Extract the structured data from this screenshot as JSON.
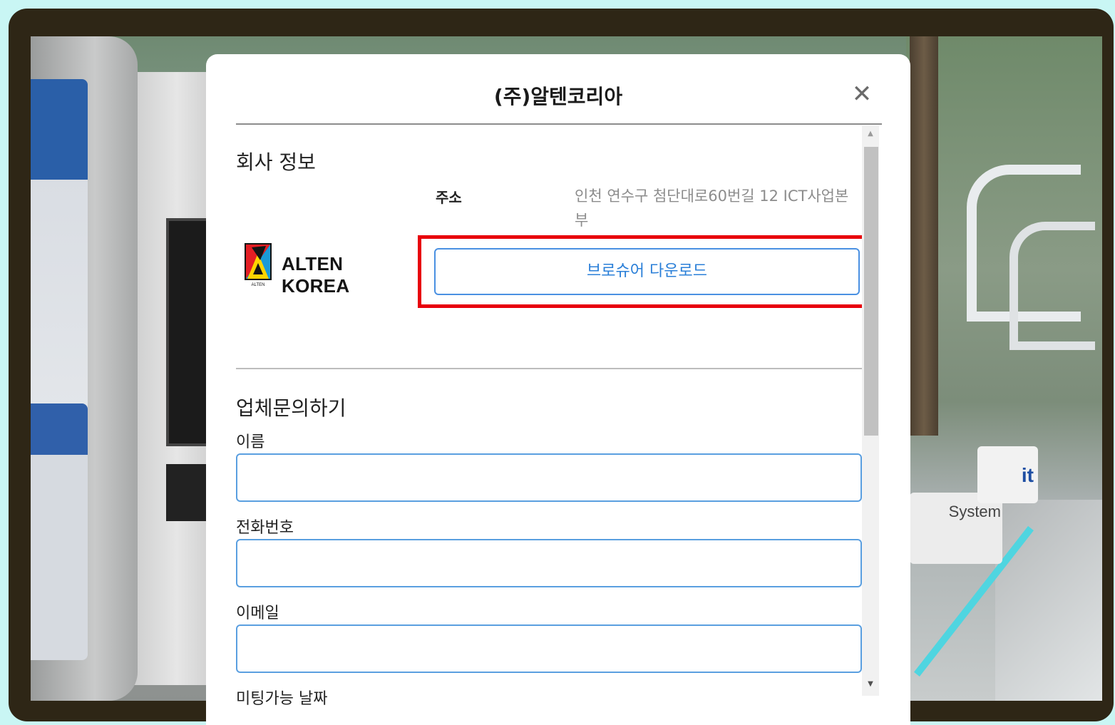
{
  "modal": {
    "title": "(주)알텐코리아",
    "close_symbol": "✕"
  },
  "company": {
    "section_title": "회사 정보",
    "address_label": "주소",
    "address_value": "인천 연수구 첨단대로60번길 12 ICT사업본부",
    "logo_text": "ALTEN KOREA",
    "logo_sub": "ALTEN",
    "brochure_button": "브로슈어 다운로드"
  },
  "inquiry": {
    "section_title": "업체문의하기",
    "fields": [
      {
        "label": "이름",
        "value": ""
      },
      {
        "label": "전화번호",
        "value": ""
      },
      {
        "label": "이메일",
        "value": ""
      }
    ],
    "next_label_partial": "미팅가능 날짜"
  },
  "scene": {
    "sign_text": "it",
    "sign2_text": "System"
  },
  "colors": {
    "highlight": "#e8000b",
    "button_border": "#4a90e2",
    "button_text": "#2a7fd8",
    "frame": "#2e2616",
    "background": "#c9f6f4"
  }
}
